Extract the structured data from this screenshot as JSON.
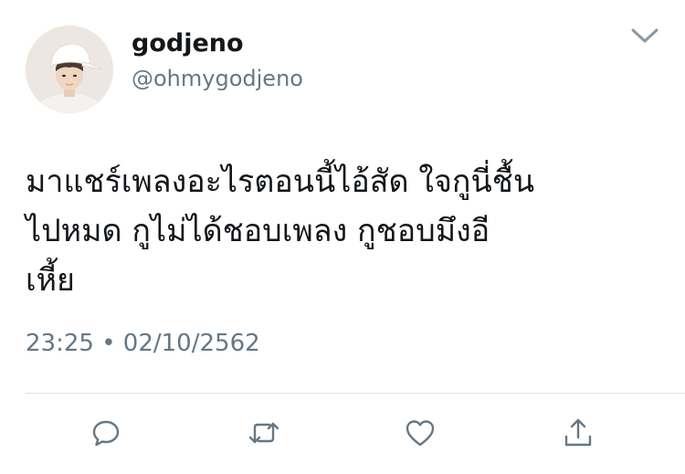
{
  "tweet": {
    "user": {
      "display_name": "godjeno",
      "handle": "@ohmygodjeno"
    },
    "text_lines": [
      "มาแชร์เพลงอะไรตอนนี้ไอ้สัด ใจกูนี่ชื้น",
      "ไปหมด กูไม่ได้ชอบเพลง กูชอบมึงอี",
      "เหี้ย"
    ],
    "timestamp": "23:25 • 02/10/2562"
  },
  "icons": {
    "menu": "chevron-down-icon",
    "reply": "reply-icon",
    "retweet": "retweet-icon",
    "like": "heart-icon",
    "share": "share-icon"
  },
  "colors": {
    "text": "#14171a",
    "secondary": "#657786",
    "icon": "#657786",
    "divider": "#dfe3e6"
  }
}
